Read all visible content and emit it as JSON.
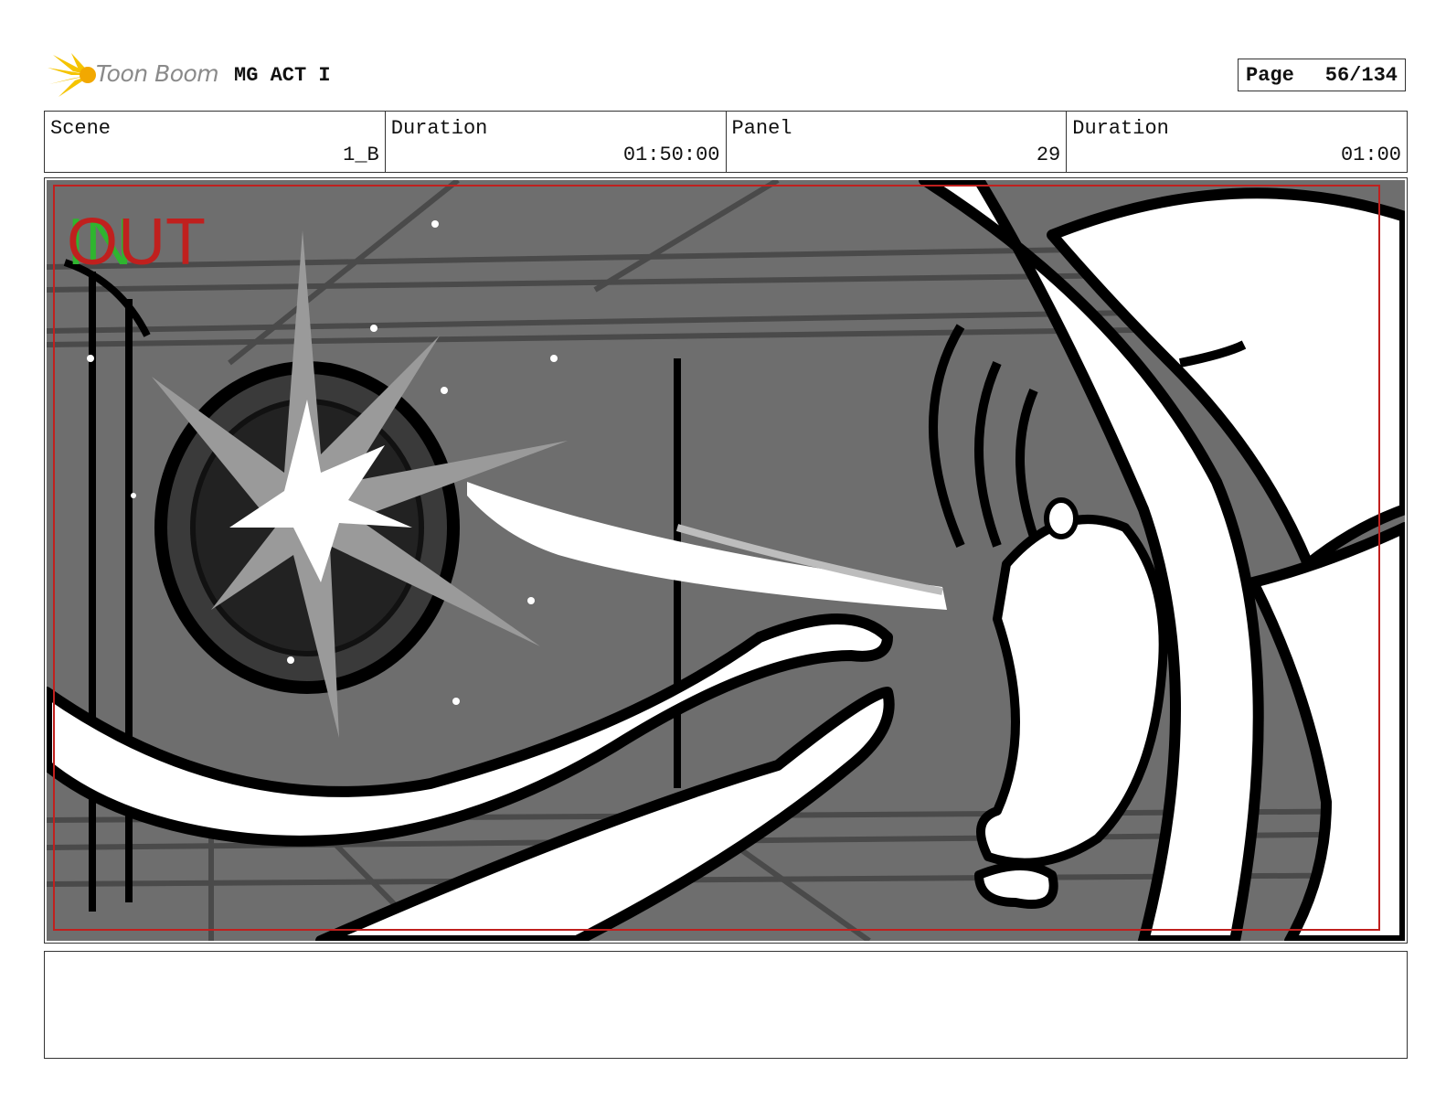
{
  "header": {
    "logo_text": "Toon Boom",
    "title": "MG ACT I",
    "page_label": "Page",
    "page_value": "56/134"
  },
  "info": {
    "scene_label": "Scene",
    "scene_value": "1_B",
    "duration_label": "Duration",
    "duration_value": "01:50:00",
    "panel_label": "Panel",
    "panel_value": "29",
    "panel_duration_label": "Duration",
    "panel_duration_value": "01:00"
  },
  "panel_image": {
    "overlay_in": "IN",
    "overlay_out": "OUT",
    "description_icon": "storyboard-sketch-image",
    "colors": {
      "bg_gray": "#6e6e6e",
      "safe_frame": "#c0201e",
      "in_green": "#2fb52f"
    }
  },
  "notes": {
    "text": ""
  }
}
